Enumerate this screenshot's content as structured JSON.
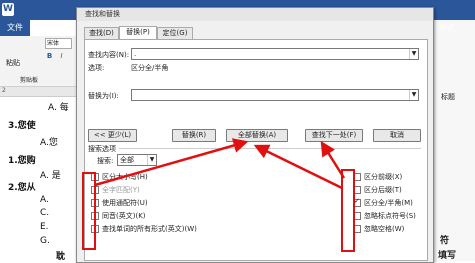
{
  "app": {
    "file_tab": "文件",
    "start_tab": "开始",
    "font_name": "宋体",
    "paste_label": "粘贴",
    "clipboard_label": "剪贴板",
    "bold_label": "B",
    "italic_label": "I",
    "ruler_number": "2",
    "right_panel_header": "样式",
    "right_panel_label": "标题",
    "right_panel_symbol": "符",
    "right_panel_fill": "填写"
  },
  "document": {
    "lines": [
      {
        "text": "A. 每",
        "bold": false
      },
      {
        "text": "3.您使",
        "bold": true
      },
      {
        "text": "A.您",
        "bold": false
      },
      {
        "text": "1.您购",
        "bold": true
      },
      {
        "text": "A. 是",
        "bold": false
      },
      {
        "text": "2.您从",
        "bold": true
      },
      {
        "text": "A.",
        "bold": false
      },
      {
        "text": "C.",
        "bold": false
      },
      {
        "text": "E.",
        "bold": false
      },
      {
        "text": "G.",
        "bold": false
      },
      {
        "text": "耽",
        "bold": true
      }
    ]
  },
  "dialog": {
    "title": "查找和替换",
    "tabs": [
      "查找(D)",
      "替换(P)",
      "定位(G)"
    ],
    "active_tab": 1,
    "find_label": "查找内容(N):",
    "find_value": ".",
    "options_label": "选项:",
    "options_value": "区分全/半角",
    "replace_label": "替换为(I):",
    "replace_value": "",
    "buttons": {
      "less": "<< 更少(L)",
      "replace": "替换(R)",
      "replace_all": "全部替换(A)",
      "find_next": "查找下一处(F)",
      "cancel": "取消"
    },
    "search_options_header": "搜索选项",
    "search_label": "搜索:",
    "search_value": "全部",
    "left_options": [
      {
        "label": "区分大小写(H)",
        "checked": false
      },
      {
        "label": "全字匹配(Y)",
        "checked": false
      },
      {
        "label": "使用通配符(U)",
        "checked": false
      },
      {
        "label": "同音(英文)(K)",
        "checked": false
      },
      {
        "label": "查找单词的所有形式(英文)(W)",
        "checked": false
      }
    ],
    "right_options": [
      {
        "label": "区分前缀(X)",
        "checked": false
      },
      {
        "label": "区分后缀(T)",
        "checked": false
      },
      {
        "label": "区分全/半角(M)",
        "checked": true
      },
      {
        "label": "忽略标点符号(S)",
        "checked": false
      },
      {
        "label": "忽略空格(W)",
        "checked": false
      }
    ]
  },
  "colors": {
    "accent": "#2b579a",
    "highlight": "#e01010"
  }
}
